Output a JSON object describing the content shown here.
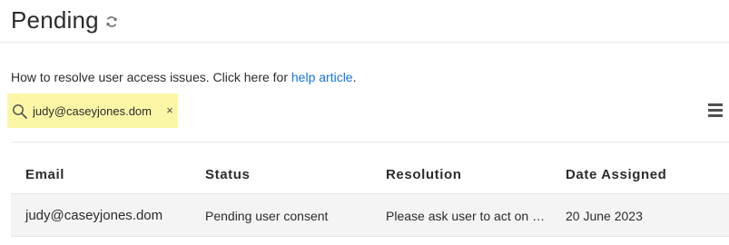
{
  "header": {
    "title": "Pending",
    "refresh_icon": "refresh-icon"
  },
  "help": {
    "text": "How to resolve user access issues. Click here for ",
    "link_text": "help article",
    "suffix": "."
  },
  "search": {
    "value": "judy@caseyjones.dom",
    "clear_label": "×",
    "icon": "search-icon",
    "highlight_color": "#fbf7a6"
  },
  "toolbar": {
    "menu_icon": "hamburger-menu-icon"
  },
  "table": {
    "columns": [
      "Email",
      "Status",
      "Resolution",
      "Date Assigned"
    ],
    "rows": [
      {
        "email": "judy@caseyjones.dom",
        "status": "Pending user consent",
        "resolution": "Please ask user to act on …",
        "date_assigned": "20 June 2023"
      }
    ]
  },
  "colors": {
    "link": "#1473e6",
    "row_background": "#f4f4f4"
  }
}
